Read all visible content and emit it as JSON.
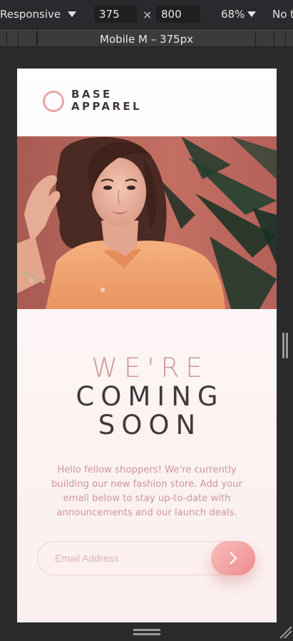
{
  "toolbar": {
    "device_label": "Responsive",
    "width_value": "375",
    "height_value": "800",
    "times_symbol": "×",
    "zoom_label": "68%",
    "throttle_label": "No t"
  },
  "ruler": {
    "device_preset": "Mobile M – 375px"
  },
  "page": {
    "logo_line1": "BASE",
    "logo_line2": "APPAREL",
    "headline_light": "WE'RE",
    "headline_dark1": "COMING",
    "headline_dark2": "SOON",
    "description": "Hello fellow shoppers! We're currently building our new fashion store. Add your email below to stay up-to-date with announcements and our launch deals.",
    "email_placeholder": "Email Address",
    "colors": {
      "accent": "#ce9797",
      "dark": "#423a3a",
      "button_start": "#f8bfbf",
      "button_end": "#ee8b8b"
    },
    "submit_icon": "chevron-right-icon",
    "hero_image": "woman-in-orange-shirt-photo"
  }
}
